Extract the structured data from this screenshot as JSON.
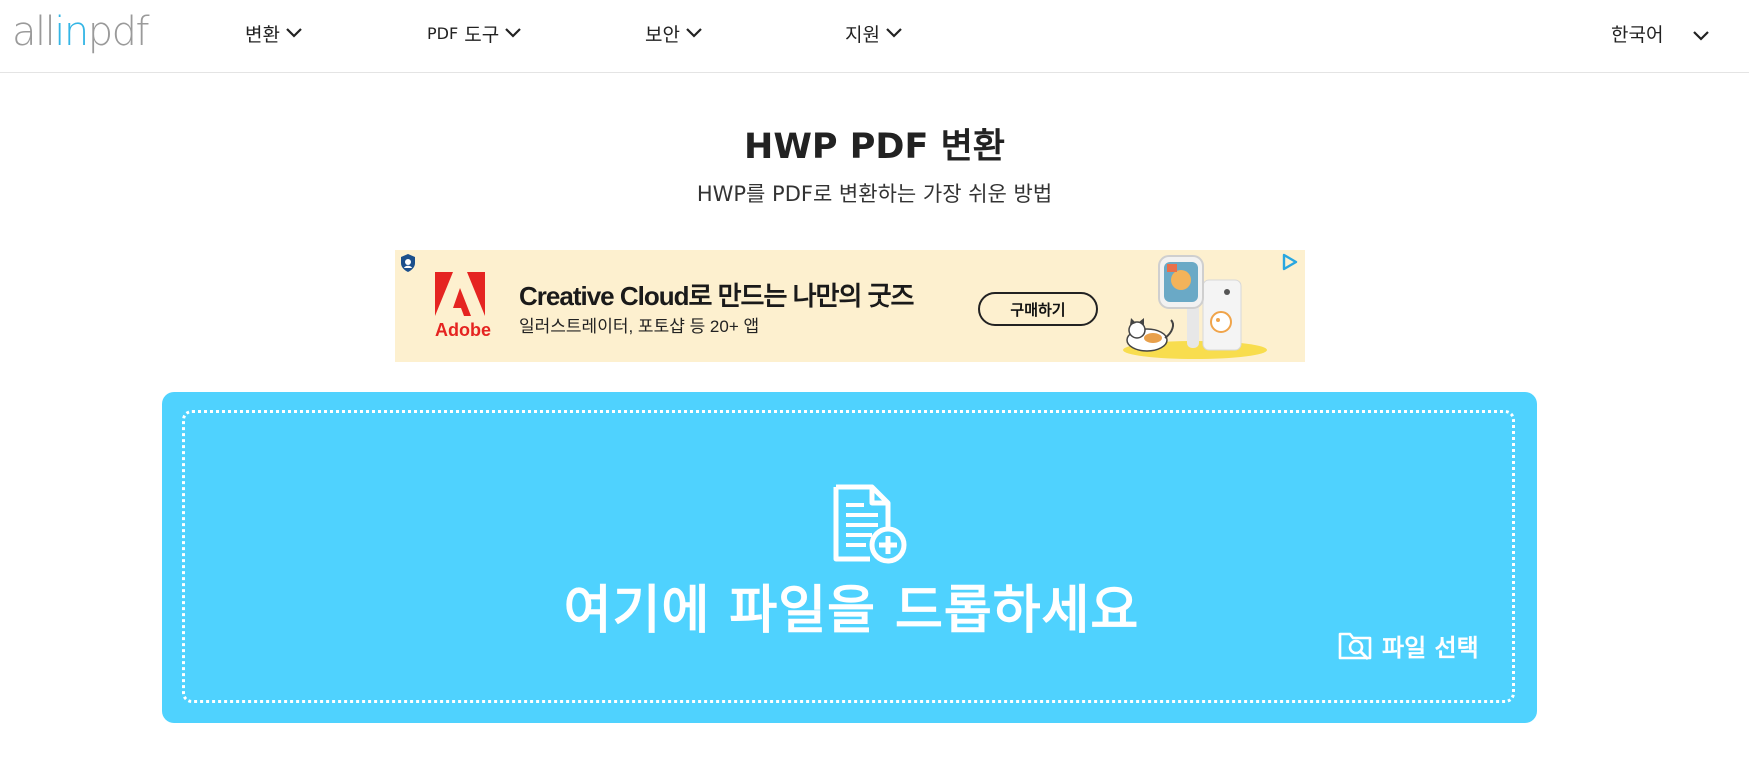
{
  "header": {
    "logo": {
      "part1": "all",
      "part2": "in",
      "part3": "pdf"
    },
    "nav": [
      {
        "label": "변환"
      },
      {
        "label_prefix": "PDF",
        "label": "도구"
      },
      {
        "label": "보안"
      },
      {
        "label": "지원"
      }
    ],
    "language": "한국어"
  },
  "main": {
    "title": "HWP PDF 변환",
    "subtitle": "HWP를 PDF로 변환하는 가장 쉬운 방법"
  },
  "ad": {
    "brand": "Adobe",
    "headline": "Creative Cloud로 만드는 나만의 굿즈",
    "subline": "일러스트레이터, 포토샵 등 20+ 앱",
    "button": "구매하기"
  },
  "upload": {
    "drop_text": "여기에 파일을 드롭하세요",
    "select_label": "파일 선택"
  },
  "colors": {
    "accent": "#4fd2fe",
    "logo_accent": "#33b5e5",
    "ad_background": "#fdf0cf"
  }
}
